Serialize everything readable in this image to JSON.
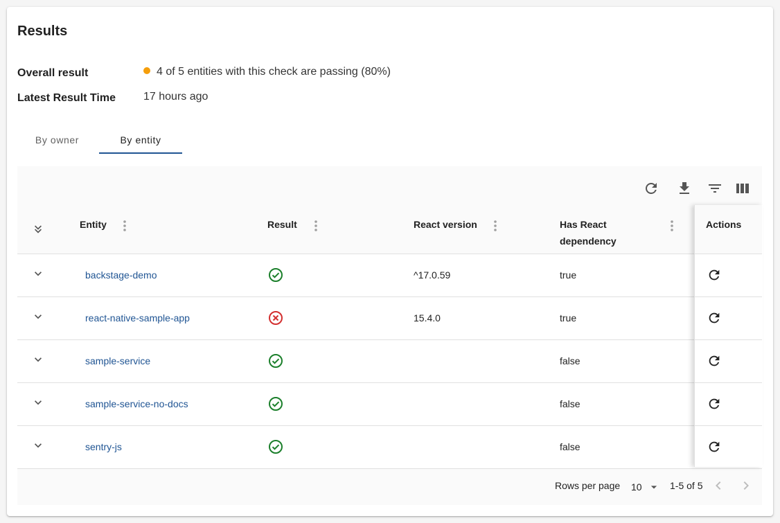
{
  "card": {
    "title": "Results"
  },
  "summary": {
    "overall_label": "Overall result",
    "overall_value": "4 of 5 entities with this check are passing (80%)",
    "overall_status_color": "#f59e0b",
    "latest_label": "Latest Result Time",
    "latest_value": "17 hours ago"
  },
  "tabs": [
    {
      "label": "By owner",
      "active": false
    },
    {
      "label": "By entity",
      "active": true
    }
  ],
  "toolbar": {
    "icons": [
      "refresh-icon",
      "download-icon",
      "filter-icon",
      "columns-icon"
    ]
  },
  "table": {
    "columns": {
      "entity": "Entity",
      "result": "Result",
      "react_version": "React version",
      "has_react_line1": "Has React",
      "has_react_line2": "dependency",
      "actions": "Actions"
    },
    "rows": [
      {
        "entity": "backstage-demo",
        "result": "pass",
        "react_version": "^17.0.59",
        "has_react": "true"
      },
      {
        "entity": "react-native-sample-app",
        "result": "fail",
        "react_version": "15.4.0",
        "has_react": "true"
      },
      {
        "entity": "sample-service",
        "result": "pass",
        "react_version": "",
        "has_react": "false"
      },
      {
        "entity": "sample-service-no-docs",
        "result": "pass",
        "react_version": "",
        "has_react": "false"
      },
      {
        "entity": "sentry-js",
        "result": "pass",
        "react_version": "",
        "has_react": "false"
      }
    ]
  },
  "footer": {
    "rows_per_page_label": "Rows per page",
    "rows_per_page_value": "10",
    "range": "1-5 of 5"
  },
  "colors": {
    "pass": "#1b7f2b",
    "fail": "#d32f2f",
    "link": "#1f5493",
    "tab_indicator": "#1f5493"
  }
}
